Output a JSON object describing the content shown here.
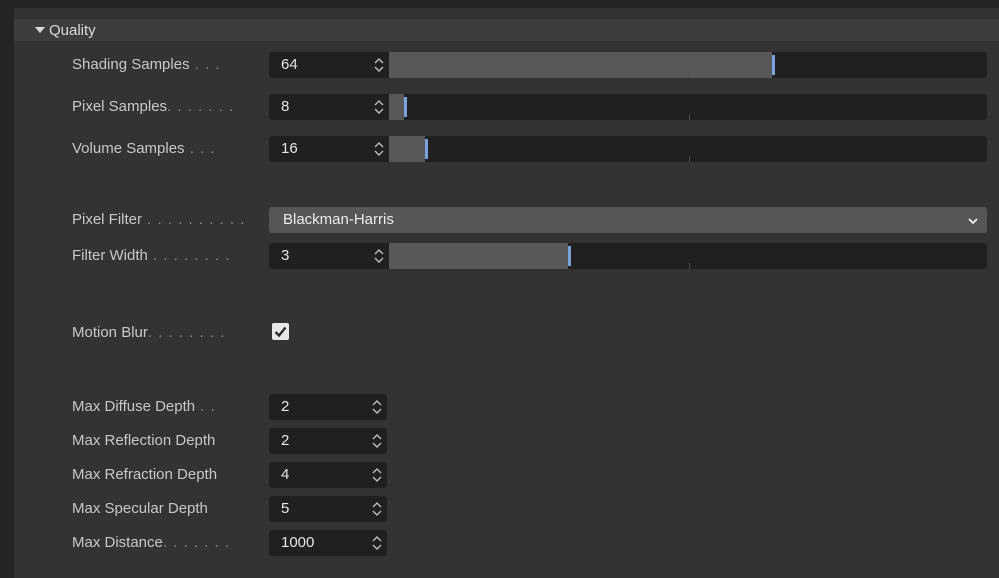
{
  "section": {
    "title": "Quality"
  },
  "rows": {
    "shading_samples": {
      "label": "Shading Samples",
      "dots": " . . .",
      "value": "64",
      "fill_fraction": 0.64
    },
    "pixel_samples": {
      "label": "Pixel Samples",
      "dots": ". . . . . . .",
      "value": "8",
      "fill_fraction": 0.025
    },
    "volume_samples": {
      "label": "Volume Samples",
      "dots": " . . .",
      "value": "16",
      "fill_fraction": 0.06
    },
    "pixel_filter": {
      "label": "Pixel Filter",
      "dots": " . . . . . . . . . .",
      "value": "Blackman-Harris"
    },
    "filter_width": {
      "label": "Filter Width",
      "dots": " . . . . . . . .",
      "value": "3",
      "fill_fraction": 0.3
    },
    "motion_blur": {
      "label": "Motion Blur",
      "dots": ". . . . . . . .",
      "checked": true
    },
    "max_diffuse_depth": {
      "label": "Max Diffuse Depth",
      "dots": " . .",
      "value": "2"
    },
    "max_reflection_depth": {
      "label": "Max Reflection Depth",
      "dots": "",
      "value": "2"
    },
    "max_refraction_depth": {
      "label": "Max Refraction Depth",
      "dots": "",
      "value": "4"
    },
    "max_specular_depth": {
      "label": "Max Specular Depth",
      "dots": "",
      "value": "5"
    },
    "max_distance": {
      "label": "Max Distance",
      "dots": ". . . . . . .",
      "value": "1000"
    }
  },
  "colors": {
    "accent": "#7aa2dc",
    "background": "#333333",
    "field": "#202020"
  },
  "icons": {
    "collapse": "triangle-down-icon",
    "spinner": "spinner-arrows-icon",
    "dropdown": "chevron-down-icon",
    "check": "checkmark-icon"
  }
}
